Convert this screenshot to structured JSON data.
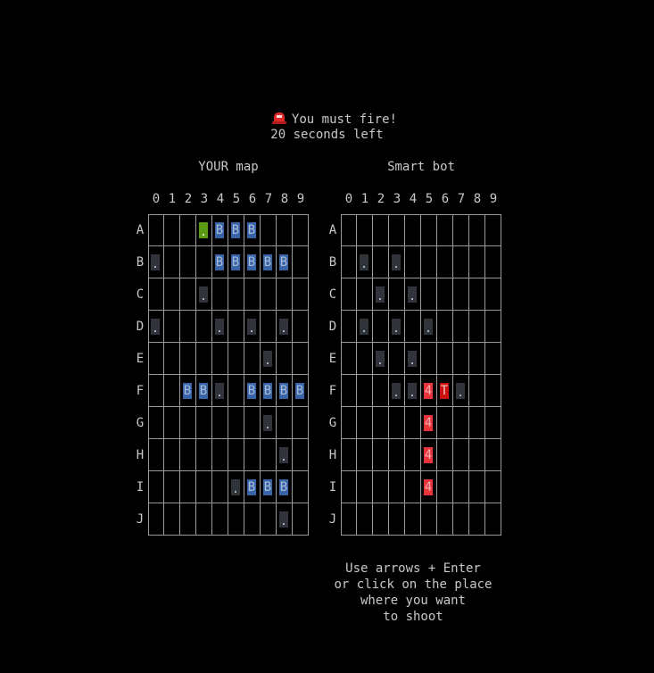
{
  "status": {
    "icon": "siren-icon",
    "message": "You must fire!",
    "timer": "20 seconds left"
  },
  "columns": [
    "0",
    "1",
    "2",
    "3",
    "4",
    "5",
    "6",
    "7",
    "8",
    "9"
  ],
  "rows": [
    "A",
    "B",
    "C",
    "D",
    "E",
    "F",
    "G",
    "H",
    "I",
    "J"
  ],
  "legend": {
    ".": "miss",
    "B": "ship",
    "4": "hit",
    "T": "hit-last",
    "*": "cursor"
  },
  "boards": [
    {
      "title": "YOUR map",
      "grid": [
        "   *BBB   ",
        ".   BBBBB ",
        "   .      ",
        ".   . . . ",
        "       .  ",
        "  BB. BBBB",
        "       .  ",
        "        . ",
        "     .BBB ",
        "        . "
      ]
    },
    {
      "title": "Smart bot",
      "grid": [
        "          ",
        " . .      ",
        "  . .     ",
        " . . .    ",
        "  . .     ",
        "   ..4T.  ",
        "     4    ",
        "     4    ",
        "     4    ",
        "          "
      ]
    }
  ],
  "help": [
    "Use arrows + Enter",
    "or click on the place",
    "where you want",
    "to shoot"
  ]
}
